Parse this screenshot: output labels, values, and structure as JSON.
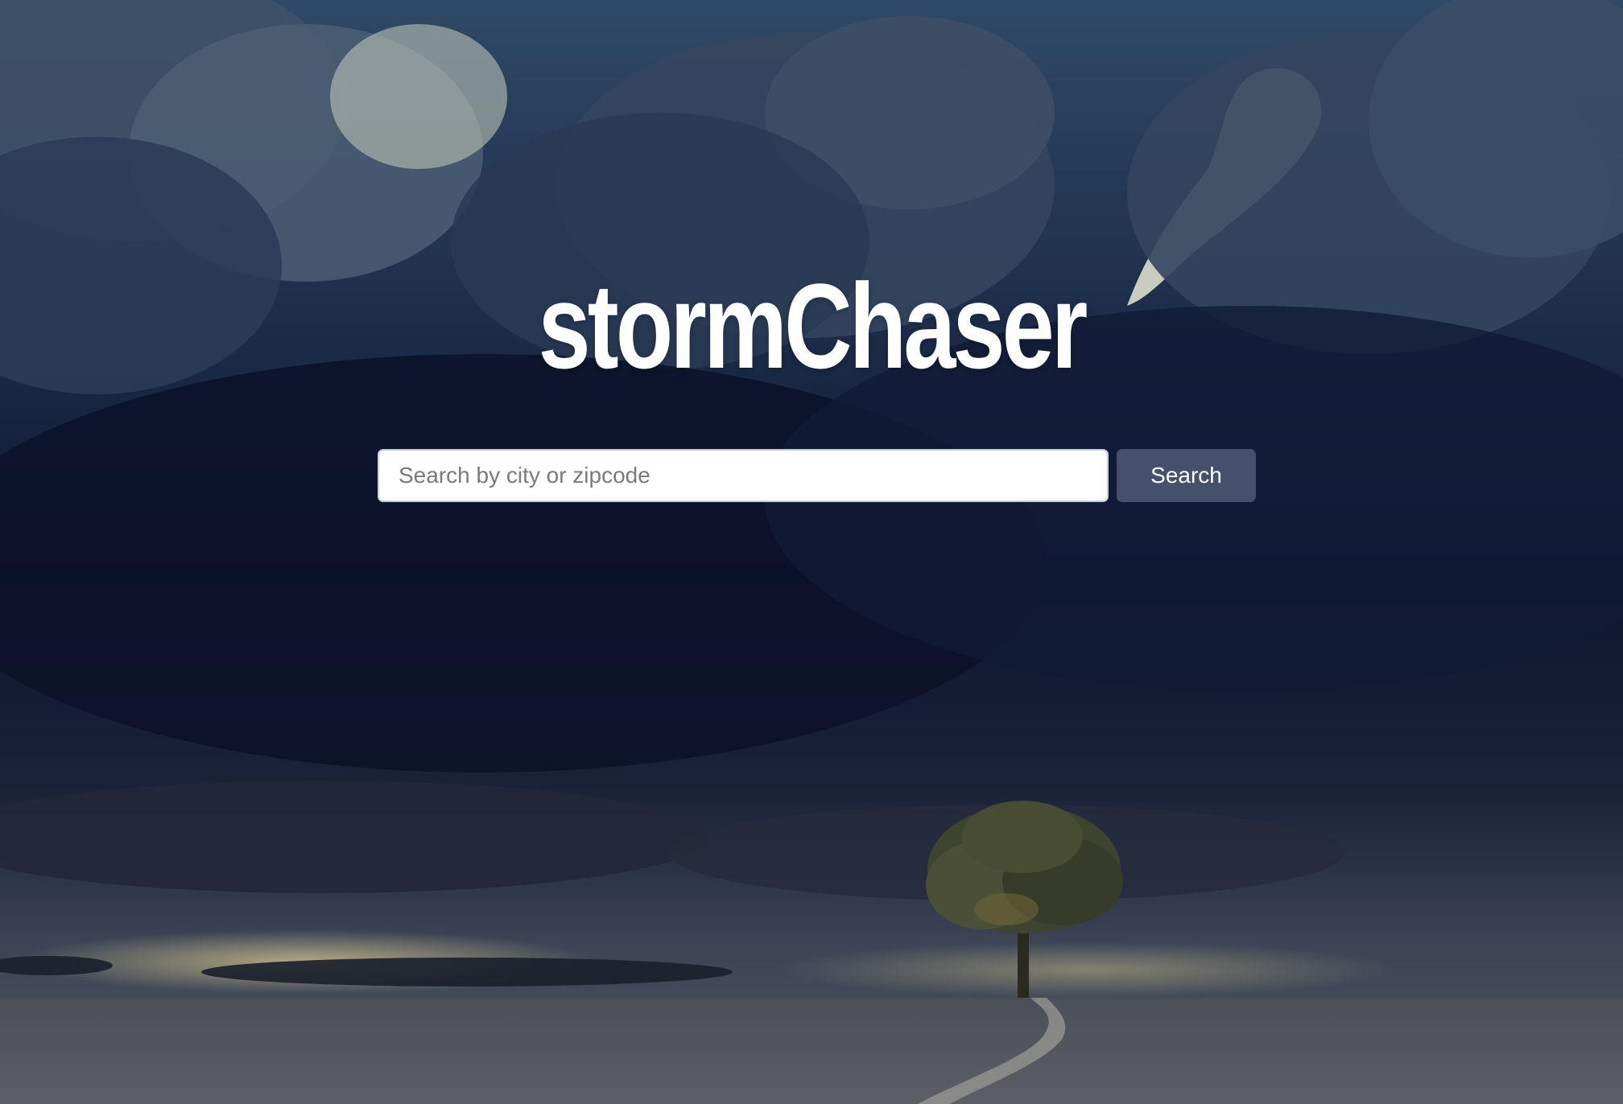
{
  "app": {
    "title": "stormChaser"
  },
  "search": {
    "placeholder": "Search by city or zipcode",
    "value": "",
    "button_label": "Search"
  },
  "colors": {
    "button_bg": "#45506c",
    "title_color": "#ffffff",
    "sky_dark": "#0d1530",
    "sky_light": "#f4f4dc"
  }
}
